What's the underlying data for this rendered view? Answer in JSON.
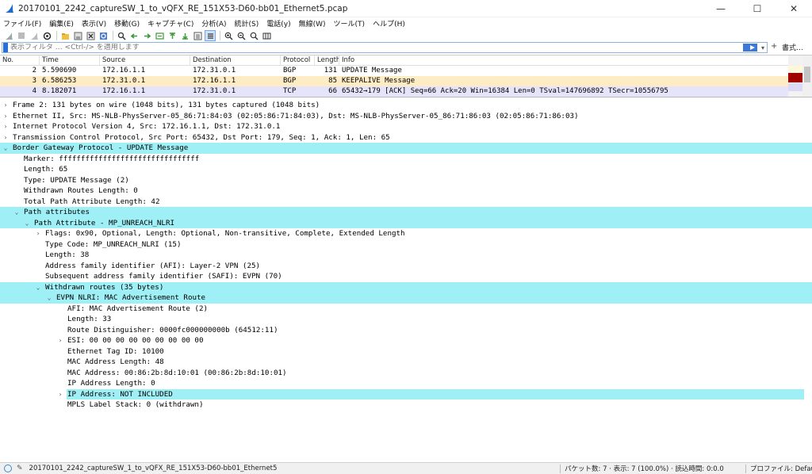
{
  "window": {
    "title": "20170101_2242_captureSW_1_to_vQFX_RE_151X53-D60-bb01_Ethernet5.pcap",
    "minimize": "—",
    "maximize": "☐",
    "close": "✕"
  },
  "menu": [
    "ファイル(F)",
    "編集(E)",
    "表示(V)",
    "移動(G)",
    "キャプチャ(C)",
    "分析(A)",
    "統計(S)",
    "電話(y)",
    "無線(W)",
    "ツール(T)",
    "ヘルプ(H)"
  ],
  "filter": {
    "placeholder": "表示フィルタ … <Ctrl-/> を適用します",
    "plus": "+",
    "format_label": "書式…"
  },
  "packet_list": {
    "columns": [
      "No.",
      "Time",
      "Source",
      "Destination",
      "Protocol",
      "Length",
      "Info"
    ],
    "rows": [
      {
        "no": "2",
        "time": "5.590690",
        "src": "172.16.1.1",
        "dst": "172.31.0.1",
        "proto": "BGP",
        "len": "131",
        "info": "UPDATE Message"
      },
      {
        "no": "3",
        "time": "6.586253",
        "src": "172.31.0.1",
        "dst": "172.16.1.1",
        "proto": "BGP",
        "len": "85",
        "info": "KEEPALIVE Message"
      },
      {
        "no": "4",
        "time": "8.182071",
        "src": "172.16.1.1",
        "dst": "172.31.0.1",
        "proto": "TCP",
        "len": "66",
        "info": "65432→179 [ACK] Seq=66 Ack=20 Win=16384 Len=0 TSval=147696892 TSecr=10556795"
      }
    ]
  },
  "detail": [
    "Frame 2: 131 bytes on wire (1048 bits), 131 bytes captured (1048 bits)",
    "Ethernet II, Src: MS-NLB-PhysServer-05_86:71:84:03 (02:05:86:71:84:03), Dst: MS-NLB-PhysServer-05_86:71:86:03 (02:05:86:71:86:03)",
    "Internet Protocol Version 4, Src: 172.16.1.1, Dst: 172.31.0.1",
    "Transmission Control Protocol, Src Port: 65432, Dst Port: 179, Seq: 1, Ack: 1, Len: 65",
    "Border Gateway Protocol - UPDATE Message",
    "Marker: ffffffffffffffffffffffffffffffff",
    "Length: 65",
    "Type: UPDATE Message (2)",
    "Withdrawn Routes Length: 0",
    "Total Path Attribute Length: 42",
    "Path attributes",
    "Path Attribute - MP_UNREACH_NLRI",
    "Flags: 0x90, Optional, Length: Optional, Non-transitive, Complete, Extended Length",
    "Type Code: MP_UNREACH_NLRI (15)",
    "Length: 38",
    "Address family identifier (AFI): Layer-2 VPN (25)",
    "Subsequent address family identifier (SAFI): EVPN (70)",
    "Withdrawn routes (35 bytes)",
    "EVPN NLRI: MAC Advertisement Route",
    "AFI: MAC Advertisement Route (2)",
    "Length: 33",
    "Route Distinguisher: 0000fc000000000b (64512:11)",
    "ESI: 00 00 00 00 00 00 00 00 00",
    "Ethernet Tag ID: 10100",
    "MAC Address Length: 48",
    "MAC Address: 00:86:2b:8d:10:01 (00:86:2b:8d:10:01)",
    "IP Address Length: 0",
    "IP Address: NOT INCLUDED",
    "MPLS Label Stack: 0 (withdrawn)"
  ],
  "status": {
    "file": "20170101_2242_captureSW_1_to_vQFX_RE_151X53-D60-bb01_Ethernet5",
    "packets": "パケット数: 7 · 表示: 7 (100.0%) · 読込時間: 0:0.0",
    "profile": "プロファイル: Default"
  },
  "colors": {
    "highlight": "#9ff0f6",
    "row_bgp_selected": "#feedc4",
    "row_tcp": "#e6e4fb"
  }
}
